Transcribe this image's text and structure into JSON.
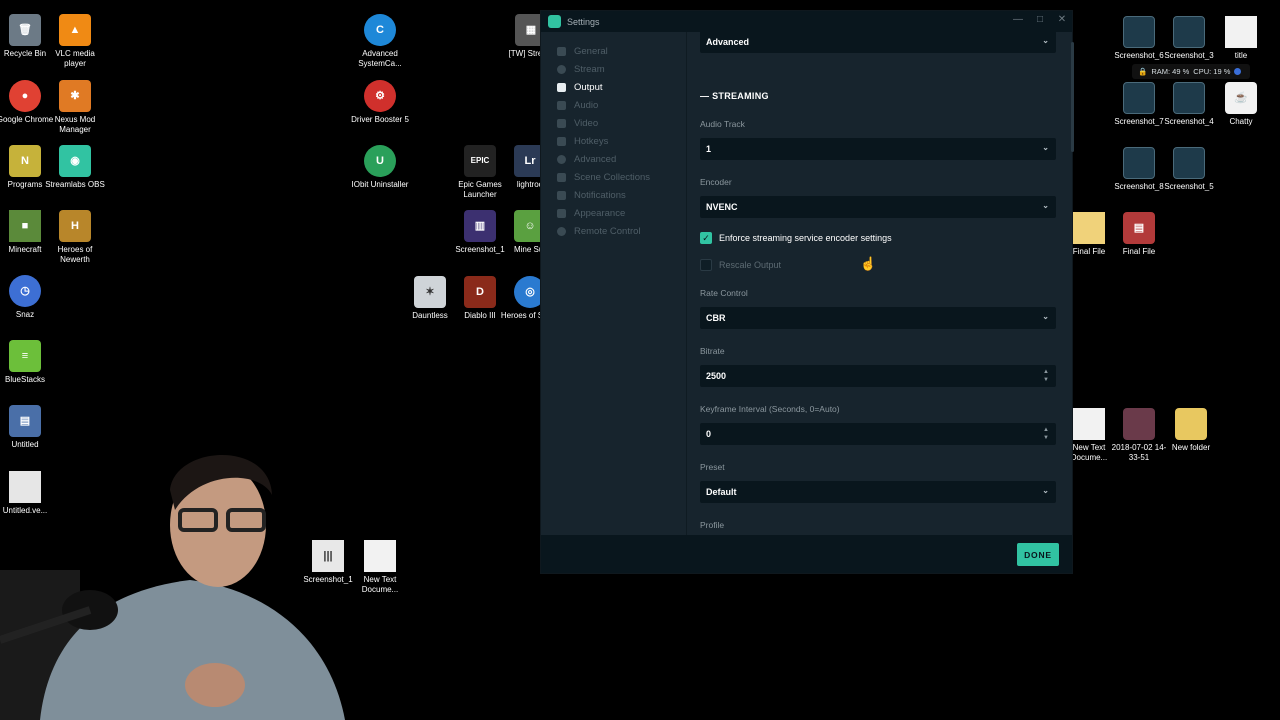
{
  "window": {
    "title": "Settings",
    "minimize": "—",
    "maximize": "□",
    "close": "✕"
  },
  "sidebar": {
    "items": [
      {
        "label": "General",
        "icon": "grid-icon",
        "active": false
      },
      {
        "label": "Stream",
        "icon": "globe-icon",
        "active": false
      },
      {
        "label": "Output",
        "icon": "output-icon",
        "active": true
      },
      {
        "label": "Audio",
        "icon": "speaker-icon",
        "active": false
      },
      {
        "label": "Video",
        "icon": "film-icon",
        "active": false
      },
      {
        "label": "Hotkeys",
        "icon": "keyboard-icon",
        "active": false
      },
      {
        "label": "Advanced",
        "icon": "gears-icon",
        "active": false
      },
      {
        "label": "Scene Collections",
        "icon": "collection-icon",
        "active": false
      },
      {
        "label": "Notifications",
        "icon": "warning-icon",
        "active": false
      },
      {
        "label": "Appearance",
        "icon": "monitor-icon",
        "active": false
      },
      {
        "label": "Remote Control",
        "icon": "remote-icon",
        "active": false
      }
    ]
  },
  "output": {
    "mode_value": "Advanced",
    "section_title": "STREAMING",
    "audio_track": {
      "label": "Audio Track",
      "value": "1"
    },
    "encoder": {
      "label": "Encoder",
      "value": "NVENC"
    },
    "enforce": {
      "label": "Enforce streaming service encoder settings",
      "checked": true
    },
    "rescale": {
      "label": "Rescale Output",
      "checked": false
    },
    "rate_control": {
      "label": "Rate Control",
      "value": "CBR"
    },
    "bitrate": {
      "label": "Bitrate",
      "value": "2500"
    },
    "keyframe": {
      "label": "Keyframe Interval (Seconds, 0=Auto)",
      "value": "0"
    },
    "preset": {
      "label": "Preset",
      "value": "Default"
    },
    "profile": {
      "label": "Profile"
    }
  },
  "footer": {
    "done_label": "DONE"
  },
  "tray": {
    "ram": "RAM: 49 %",
    "cpu": "CPU: 19 %"
  },
  "colors": {
    "accent": "#31c3a2",
    "window_bg": "#17242d",
    "input_bg": "#09161d"
  },
  "desktop_icons": [
    {
      "label": "Recycle Bin",
      "color": "#6c7a86"
    },
    {
      "label": "VLC media player",
      "color": "#f08a14"
    },
    {
      "label": "Google Chrome",
      "color": "#e04133"
    },
    {
      "label": "Nexus Mod Manager",
      "color": "#e07a24"
    },
    {
      "label": "Programs",
      "color": "#c6b23a"
    },
    {
      "label": "Streamlabs OBS",
      "color": "#31c3a2"
    },
    {
      "label": "Minecraft",
      "color": "#5b8a3a"
    },
    {
      "label": "Heroes of Newerth",
      "color": "#b8862a"
    },
    {
      "label": "Snaz",
      "color": "#3d6fd4"
    },
    {
      "label": "BlueStacks",
      "color": "#6cbf3a"
    },
    {
      "label": "Untitled",
      "color": "#4a6fa8"
    },
    {
      "label": "Untitled.ve...",
      "color": "#e6e6e6"
    },
    {
      "label": "Advanced SystemCa...",
      "color": "#1e88d8"
    },
    {
      "label": "Driver Booster 5",
      "color": "#d0302c"
    },
    {
      "label": "IObit Uninstaller",
      "color": "#2aa05a"
    },
    {
      "label": "[TW] Stream",
      "color": "#555555"
    },
    {
      "label": "Epic Games Launcher",
      "color": "#222222"
    },
    {
      "label": "lightroo",
      "color": "#2b3a55"
    },
    {
      "label": "Screenshot_1",
      "color": "#3c3070"
    },
    {
      "label": "Mine Sur",
      "color": "#5aa040"
    },
    {
      "label": "Dauntless",
      "color": "#cfd4d8"
    },
    {
      "label": "Diablo III",
      "color": "#8a2a1a"
    },
    {
      "label": "Heroes of Storm",
      "color": "#2a7ad0"
    },
    {
      "label": "Screenshot_1",
      "color": "#e8e8e8"
    },
    {
      "label": "New Text Docume...",
      "color": "#f2f2f2"
    },
    {
      "label": "Screenshot_6",
      "color": "#1e3a4a"
    },
    {
      "label": "Screenshot_3",
      "color": "#1e3a4a"
    },
    {
      "label": "title",
      "color": "#f2f2f2"
    },
    {
      "label": "Screenshot_7",
      "color": "#1e3a4a"
    },
    {
      "label": "Screenshot_4",
      "color": "#1e3a4a"
    },
    {
      "label": "Chatty",
      "color": "#d45a2a"
    },
    {
      "label": "Screenshot_8",
      "color": "#1e3a4a"
    },
    {
      "label": "Screenshot_5",
      "color": "#1e3a4a"
    },
    {
      "label": "Final File",
      "color": "#f0d27a"
    },
    {
      "label": "Final File",
      "color": "#b23a3a"
    },
    {
      "label": "New Text Docume...",
      "color": "#f2f2f2"
    },
    {
      "label": "2018-07-02 14-33-51",
      "color": "#6a3a4a"
    },
    {
      "label": "New folder",
      "color": "#e8c860"
    }
  ]
}
